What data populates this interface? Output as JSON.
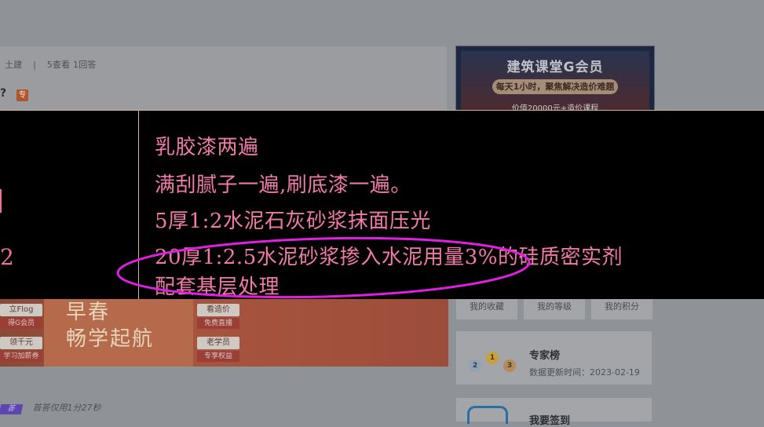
{
  "question": {
    "category": "土建",
    "views": "5查看",
    "answers": "1回答",
    "title_tail": "?",
    "badge": "专"
  },
  "vip_banner": {
    "title": "建筑课堂G会员",
    "pill": "每天1小时，聚焦解决造价难题",
    "sub": "价值20000元+造价课程"
  },
  "cad": {
    "lines": [
      "乳胶漆两遍",
      "满刮腻子一遍,刷底漆一遍。",
      "5厚1:2水泥石灰砂浆抹面压光",
      "20厚1:2.5水泥砂浆掺入水泥用量3%的硅质密实剂",
      "配套基层处理"
    ],
    "left_fragment": "2",
    "text_color": "#f07aa8",
    "ellipse_color": "#e020e0"
  },
  "promo": {
    "btn_flag": "立Flog",
    "sub_flag": "得G会员",
    "btn_coupon": "领千元",
    "sub_coupon": "学习加薪券",
    "headline_1": "早春",
    "headline_2": "畅学起航",
    "btn_price": "看造价",
    "sub_price": "免费直播",
    "btn_alumni": "老学员",
    "sub_alumni": "专享权益"
  },
  "right_panel": {
    "favorites": "我的收藏",
    "level": "我的等级",
    "points": "我的积分",
    "expert_title": "专家榜",
    "expert_date": "数据更新时间：2023-02-19",
    "medal_1": "1",
    "medal_2": "2",
    "medal_3": "3",
    "sign_title": "我要签到"
  },
  "answer_bar": {
    "tag": "答",
    "text": "首答仅用1分27秒"
  }
}
